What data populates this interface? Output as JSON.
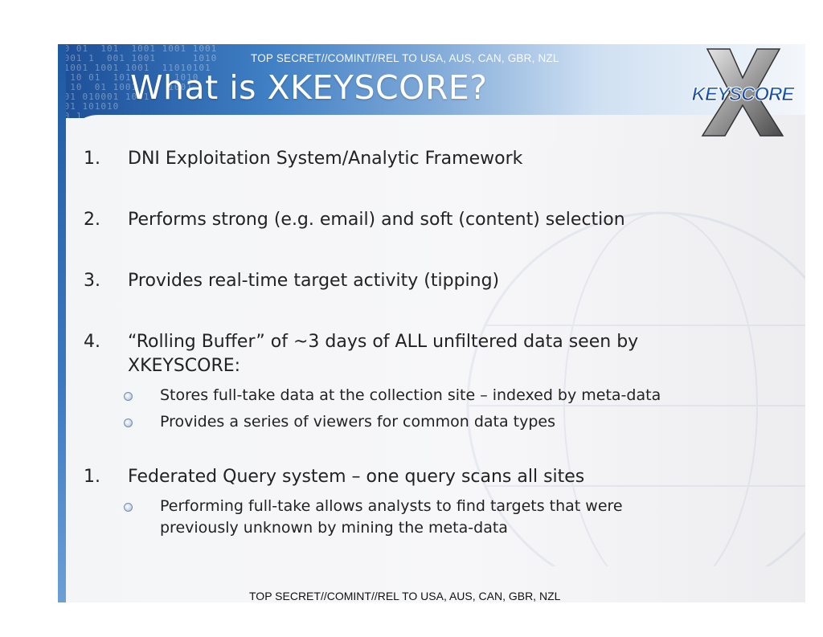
{
  "header": {
    "classification": "TOP SECRET//COMINT//REL TO USA, AUS, CAN, GBR, NZL",
    "title": "What is XKEYSCORE?",
    "binary_lines": [
      "10 01  101  1001 1001 1001",
      "1001 1  001 1001      1010",
      " 1001 1001 1001  11010101",
      "0 10 01  101       1010",
      "0 10  01 1001     1001",
      "101 010001 1001",
      " 01 101010",
      "10 1",
      "1",
      "0",
      "1"
    ]
  },
  "logo": {
    "text": "KEYSCORE",
    "icon": "x-logo-icon"
  },
  "items": [
    {
      "num": "1.",
      "text": "DNI Exploitation System/Analytic Framework"
    },
    {
      "num": "2.",
      "text": "Performs strong (e.g. email) and soft (content) selection"
    },
    {
      "num": "3.",
      "text": "Provides real-time target activity (tipping)"
    },
    {
      "num": "4.",
      "text_line1": "“Rolling Buffer” of ~3 days of ALL unfiltered data seen by",
      "text_line2": "XKEYSCORE:"
    },
    {
      "num": "1.",
      "text": "Federated Query system – one query scans all sites"
    }
  ],
  "subitems": [
    {
      "text": "Stores full-take data at the collection site – indexed by meta-data"
    },
    {
      "text": "Provides a series of viewers for common data types"
    },
    {
      "text_line1": "Performing full-take allows analysts to find targets that were",
      "text_line2": "previously unknown by mining the meta-data"
    }
  ],
  "footer": {
    "classification": "TOP SECRET//COMINT//REL TO USA, AUS, CAN, GBR, NZL"
  },
  "colors": {
    "header_dark": "#1c4e96",
    "header_light": "#cfe0f2",
    "text": "#222222"
  }
}
